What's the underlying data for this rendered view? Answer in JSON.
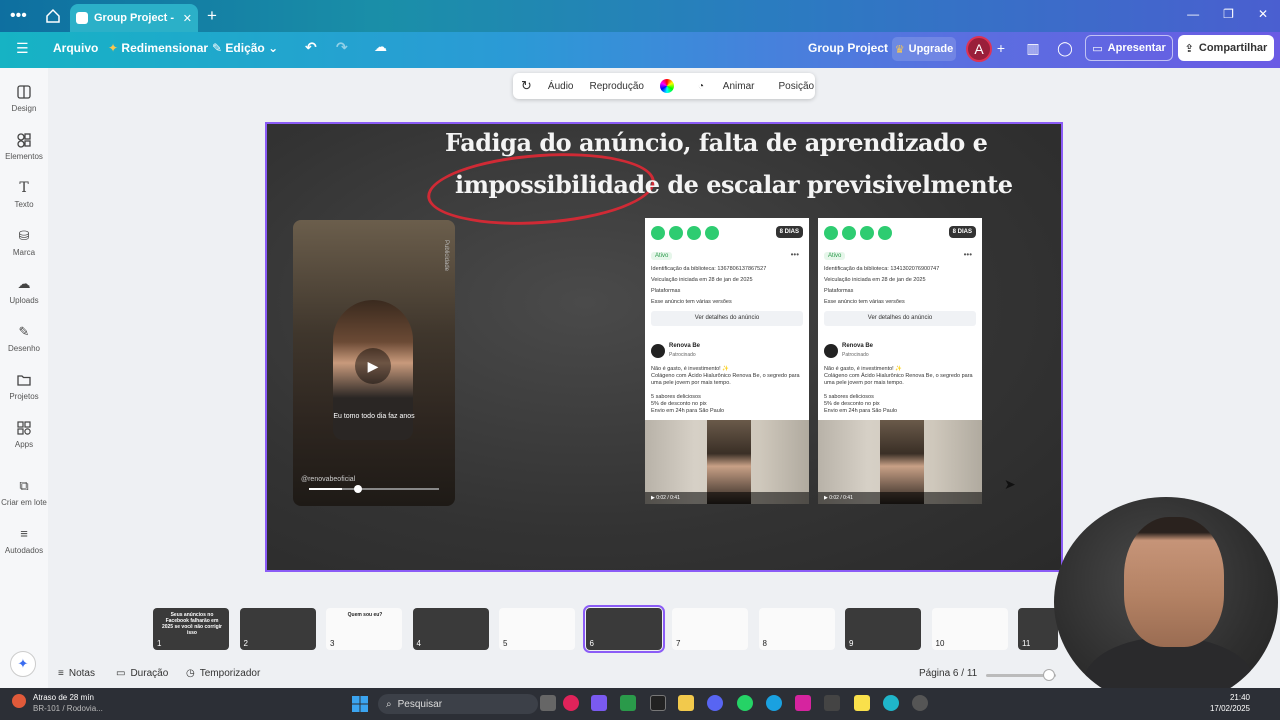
{
  "browser": {
    "tab_title": "Group Project - Ap..."
  },
  "toolbar": {
    "file": "Arquivo",
    "resize": "Redimensionar",
    "edit": "Edição",
    "project_name": "Group Project",
    "upgrade": "Upgrade",
    "avatar_letter": "A",
    "present": "Apresentar",
    "share": "Compartilhar"
  },
  "sidebar": {
    "items": [
      {
        "label": "Design",
        "icon": "layout-icon"
      },
      {
        "label": "Elementos",
        "icon": "shapes-icon"
      },
      {
        "label": "Texto",
        "icon": "text-icon"
      },
      {
        "label": "Marca",
        "icon": "brand-icon"
      },
      {
        "label": "Uploads",
        "icon": "cloud-upload-icon"
      },
      {
        "label": "Desenho",
        "icon": "pen-icon"
      },
      {
        "label": "Projetos",
        "icon": "folder-icon"
      },
      {
        "label": "Apps",
        "icon": "apps-icon"
      },
      {
        "label": "Criar em lote",
        "icon": "batch-icon"
      },
      {
        "label": "Autodados",
        "icon": "database-icon"
      }
    ]
  },
  "float_bar": {
    "audio": "Áudio",
    "playback": "Reprodução",
    "animate": "Animar",
    "position": "Posição"
  },
  "slide": {
    "title_line1": "Fadiga do anúncio, falta de aprendizado e",
    "title_line2": "impossibilidade de escalar previsivelmente",
    "video_caption": "Eu tomo todo dia faz anos",
    "video_handle": "@renovabeoficial",
    "video_side": "Publicidade",
    "video_progress": 0.25,
    "cards": [
      {
        "badge": "8 DIAS",
        "status": "Ativo",
        "library_id": "Identificação da biblioteca: 1367806137867527",
        "started": "Veiculação iniciada em 28 de jan de 2025",
        "platforms": "Plataformas",
        "versions": "Esse anúncio tem várias versões",
        "details_btn": "Ver detalhes do anúncio",
        "brand": "Renova Be",
        "sponsored": "Patrocinado",
        "body1": "Não é gasto, é investimento! ✨",
        "body2": "Colágeno com Ácido Hialurônico Renova Be, o segredo para",
        "body3": "uma pele jovem por mais tempo.",
        "b1": "5 sabores deliciosos",
        "b2": "5% de desconto no pix",
        "b3": "Envio em 24h para São Paulo",
        "time": "0:02 / 0:41"
      },
      {
        "badge": "8 DIAS",
        "status": "Ativo",
        "library_id": "Identificação da biblioteca: 1341302076900747",
        "started": "Veiculação iniciada em 28 de jan de 2025",
        "platforms": "Plataformas",
        "versions": "Esse anúncio tem várias versões",
        "details_btn": "Ver detalhes do anúncio",
        "brand": "Renova Be",
        "sponsored": "Patrocinado",
        "body1": "Não é gasto, é investimento! ✨",
        "body2": "Colágeno com Ácido Hialurônico Renova Be, o segredo para",
        "body3": "uma pele jovem por mais tempo.",
        "b1": "5 sabores deliciosos",
        "b2": "5% de desconto no pix",
        "b3": "Envio em 24h para São Paulo",
        "time": "0:02 / 0:41"
      }
    ]
  },
  "filmstrip": {
    "thumbs": [
      {
        "n": "1",
        "text": "Seus anúncios no Facebook falharão em 2025 se você não corrigir isso"
      },
      {
        "n": "2",
        "text": ""
      },
      {
        "n": "3",
        "text": "Quem sou eu?"
      },
      {
        "n": "4",
        "text": ""
      },
      {
        "n": "5",
        "text": ""
      },
      {
        "n": "6",
        "text": ""
      },
      {
        "n": "7",
        "text": ""
      },
      {
        "n": "8",
        "text": ""
      },
      {
        "n": "9",
        "text": ""
      },
      {
        "n": "10",
        "text": ""
      },
      {
        "n": "11",
        "text": ""
      }
    ],
    "selected": 6
  },
  "bottom": {
    "notes": "Notas",
    "duration": "Duração",
    "timer": "Temporizador",
    "page": "Página 6 / 11"
  },
  "taskbar": {
    "alert_line1": "Atraso de 28 mín",
    "alert_line2": "BR-101 / Rodovia...",
    "search": "Pesquisar",
    "time": "21:40",
    "date": "17/02/2025"
  },
  "colors": {
    "accent": "#8b5cf6",
    "toolbar": "#2b9ad6",
    "title_circle": "#d02a35",
    "share": "#ffffff"
  }
}
